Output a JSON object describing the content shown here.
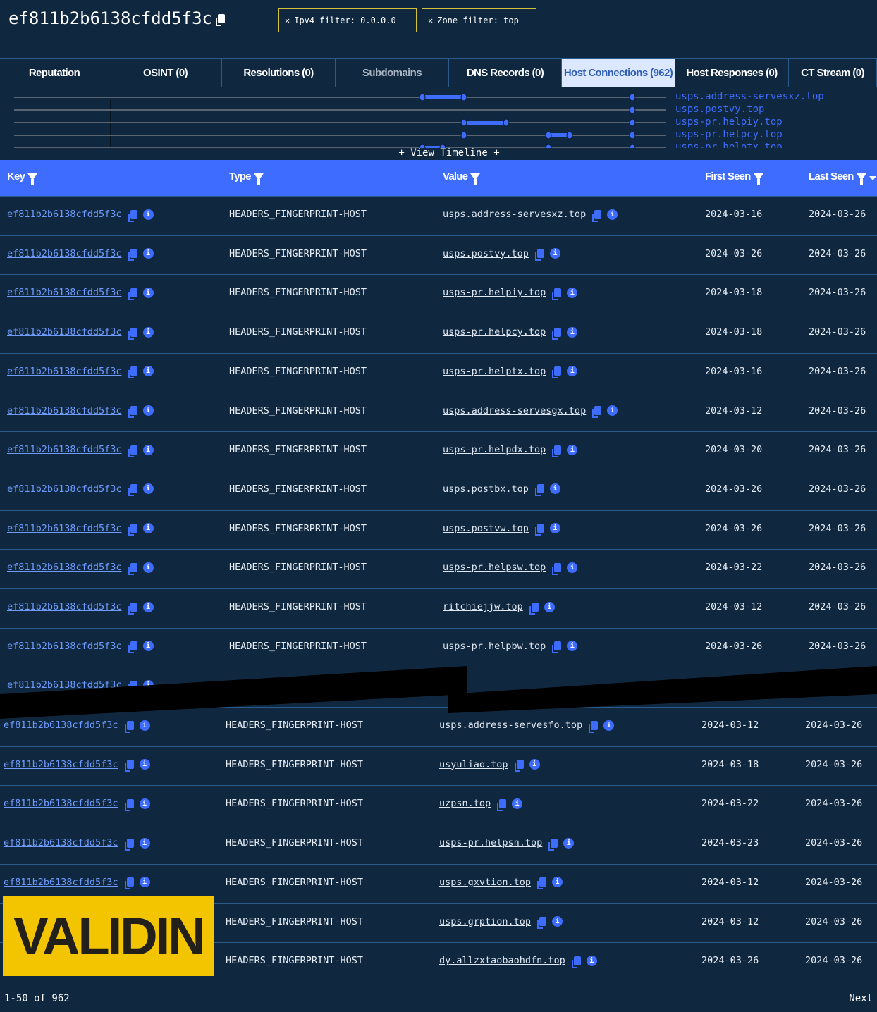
{
  "header": {
    "title": "ef811b2b6138cfdd5f3c",
    "filters": [
      {
        "label": "Ipv4 filter: 0.0.0.0"
      },
      {
        "label": "Zone filter: top"
      }
    ]
  },
  "tabs": [
    {
      "label": "Reputation"
    },
    {
      "label": "OSINT (0)"
    },
    {
      "label": "Resolutions (0)"
    },
    {
      "label": "Subdomains",
      "state": "disabled"
    },
    {
      "label": "DNS Records (0)"
    },
    {
      "label": "Host Connections (962)",
      "state": "active"
    },
    {
      "label": "Host Responses (0)"
    },
    {
      "label": "CT Stream (0)"
    }
  ],
  "timeline": {
    "labels": [
      "usps.address-servesxz.top",
      "usps.postvy.top",
      "usps-pr.helpiy.top",
      "usps-pr.helpcy.top",
      "usps-pr.helptx.top"
    ],
    "toggle": "+ View Timeline +"
  },
  "table": {
    "columns": [
      "Key",
      "Type",
      "Value",
      "First Seen",
      "Last Seen"
    ],
    "rows": [
      {
        "key": "ef811b2b6138cfdd5f3c",
        "type": "HEADERS_FINGERPRINT-HOST",
        "value": "usps.address-servesxz.top",
        "first": "2024-03-16",
        "last": "2024-03-26"
      },
      {
        "key": "ef811b2b6138cfdd5f3c",
        "type": "HEADERS_FINGERPRINT-HOST",
        "value": "usps.postvy.top",
        "first": "2024-03-26",
        "last": "2024-03-26"
      },
      {
        "key": "ef811b2b6138cfdd5f3c",
        "type": "HEADERS_FINGERPRINT-HOST",
        "value": "usps-pr.helpiy.top",
        "first": "2024-03-18",
        "last": "2024-03-26"
      },
      {
        "key": "ef811b2b6138cfdd5f3c",
        "type": "HEADERS_FINGERPRINT-HOST",
        "value": "usps-pr.helpcy.top",
        "first": "2024-03-18",
        "last": "2024-03-26"
      },
      {
        "key": "ef811b2b6138cfdd5f3c",
        "type": "HEADERS_FINGERPRINT-HOST",
        "value": "usps-pr.helptx.top",
        "first": "2024-03-16",
        "last": "2024-03-26"
      },
      {
        "key": "ef811b2b6138cfdd5f3c",
        "type": "HEADERS_FINGERPRINT-HOST",
        "value": "usps.address-servesgx.top",
        "first": "2024-03-12",
        "last": "2024-03-26"
      },
      {
        "key": "ef811b2b6138cfdd5f3c",
        "type": "HEADERS_FINGERPRINT-HOST",
        "value": "usps-pr.helpdx.top",
        "first": "2024-03-20",
        "last": "2024-03-26"
      },
      {
        "key": "ef811b2b6138cfdd5f3c",
        "type": "HEADERS_FINGERPRINT-HOST",
        "value": "usps.postbx.top",
        "first": "2024-03-26",
        "last": "2024-03-26"
      },
      {
        "key": "ef811b2b6138cfdd5f3c",
        "type": "HEADERS_FINGERPRINT-HOST",
        "value": "usps.postvw.top",
        "first": "2024-03-26",
        "last": "2024-03-26"
      },
      {
        "key": "ef811b2b6138cfdd5f3c",
        "type": "HEADERS_FINGERPRINT-HOST",
        "value": "usps-pr.helpsw.top",
        "first": "2024-03-22",
        "last": "2024-03-26"
      },
      {
        "key": "ef811b2b6138cfdd5f3c",
        "type": "HEADERS_FINGERPRINT-HOST",
        "value": "ritchiejjw.top",
        "first": "2024-03-12",
        "last": "2024-03-26"
      },
      {
        "key": "ef811b2b6138cfdd5f3c",
        "type": "HEADERS_FINGERPRINT-HOST",
        "value": "usps-pr.helpbw.top",
        "first": "2024-03-26",
        "last": "2024-03-26"
      },
      {
        "key": "ef811b2b6138cfdd5f3c",
        "type": "",
        "value": "",
        "first": "",
        "last": ""
      }
    ],
    "rows_lower": [
      {
        "key": "ef811b2b6138cfdd5f3c",
        "type": "HEADERS_FINGERPRINT-HOST",
        "value": "usps.address-servesfo.top",
        "first": "2024-03-12",
        "last": "2024-03-26"
      },
      {
        "key": "ef811b2b6138cfdd5f3c",
        "type": "HEADERS_FINGERPRINT-HOST",
        "value": "usyuliao.top",
        "first": "2024-03-18",
        "last": "2024-03-26"
      },
      {
        "key": "ef811b2b6138cfdd5f3c",
        "type": "HEADERS_FINGERPRINT-HOST",
        "value": "uzpsn.top",
        "first": "2024-03-22",
        "last": "2024-03-26"
      },
      {
        "key": "ef811b2b6138cfdd5f3c",
        "type": "HEADERS_FINGERPRINT-HOST",
        "value": "usps-pr.helpsn.top",
        "first": "2024-03-23",
        "last": "2024-03-26"
      },
      {
        "key": "ef811b2b6138cfdd5f3c",
        "type": "HEADERS_FINGERPRINT-HOST",
        "value": "usps.gxvtion.top",
        "first": "2024-03-12",
        "last": "2024-03-26"
      },
      {
        "key": "",
        "type": "HEADERS_FINGERPRINT-HOST",
        "value": "usps.grption.top",
        "first": "2024-03-12",
        "last": "2024-03-26"
      },
      {
        "key": "",
        "type": "HEADERS_FINGERPRINT-HOST",
        "value": "dy.allzxtaobaohdfn.top",
        "first": "2024-03-26",
        "last": "2024-03-26"
      }
    ]
  },
  "footer": {
    "range": "1-50 of 962",
    "next": "Next"
  },
  "logo": {
    "text": "VALIDIN"
  },
  "colors": {
    "background": "#10283f",
    "accent": "#3d6cff",
    "filter_border": "#d4c23a",
    "logo_bg": "#f2c500"
  }
}
